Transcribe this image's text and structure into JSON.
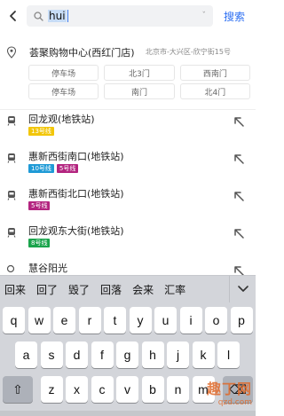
{
  "search": {
    "query": "hui",
    "dropdown_glyph": "ˇ",
    "search_label": "搜索"
  },
  "poi": {
    "name": "荟聚购物中心(西红门店)",
    "address": "北京市-大兴区-欣宁街15号",
    "gates": [
      "停车场",
      "北3门",
      "西南门",
      "停车场",
      "南门",
      "北4门"
    ]
  },
  "results": [
    {
      "title": "回龙观(地铁站)",
      "badges": [
        {
          "label": "13号线",
          "color": "#f2c60a"
        }
      ]
    },
    {
      "title": "惠新西街南口(地铁站)",
      "badges": [
        {
          "label": "10号线",
          "color": "#1f9ad6"
        },
        {
          "label": "5号线",
          "color": "#b3247f"
        }
      ]
    },
    {
      "title": "惠新西街北口(地铁站)",
      "badges": [
        {
          "label": "5号线",
          "color": "#b3247f"
        }
      ]
    },
    {
      "title": "回龙观东大街(地铁站)",
      "badges": [
        {
          "label": "8号线",
          "color": "#1aa44c"
        }
      ]
    },
    {
      "title": "慧谷阳光",
      "badges": []
    }
  ],
  "candidates": [
    "回来",
    "回了",
    "毁了",
    "回落",
    "会来",
    "汇率"
  ],
  "keyboard": {
    "row1": [
      "q",
      "w",
      "e",
      "r",
      "t",
      "y",
      "u",
      "i",
      "o",
      "p"
    ],
    "row2": [
      "a",
      "s",
      "d",
      "f",
      "g",
      "h",
      "j",
      "k",
      "l"
    ],
    "row3": [
      "z",
      "x",
      "c",
      "v",
      "b",
      "n",
      "m"
    ],
    "shift_glyph": "⇧",
    "delete_glyph": "⌫"
  },
  "watermark": {
    "line1": "趣丁网",
    "line2": "qzd.com"
  },
  "colors": {
    "accent": "#2b6ef2",
    "keyboard_bg": "#d3d5da"
  }
}
